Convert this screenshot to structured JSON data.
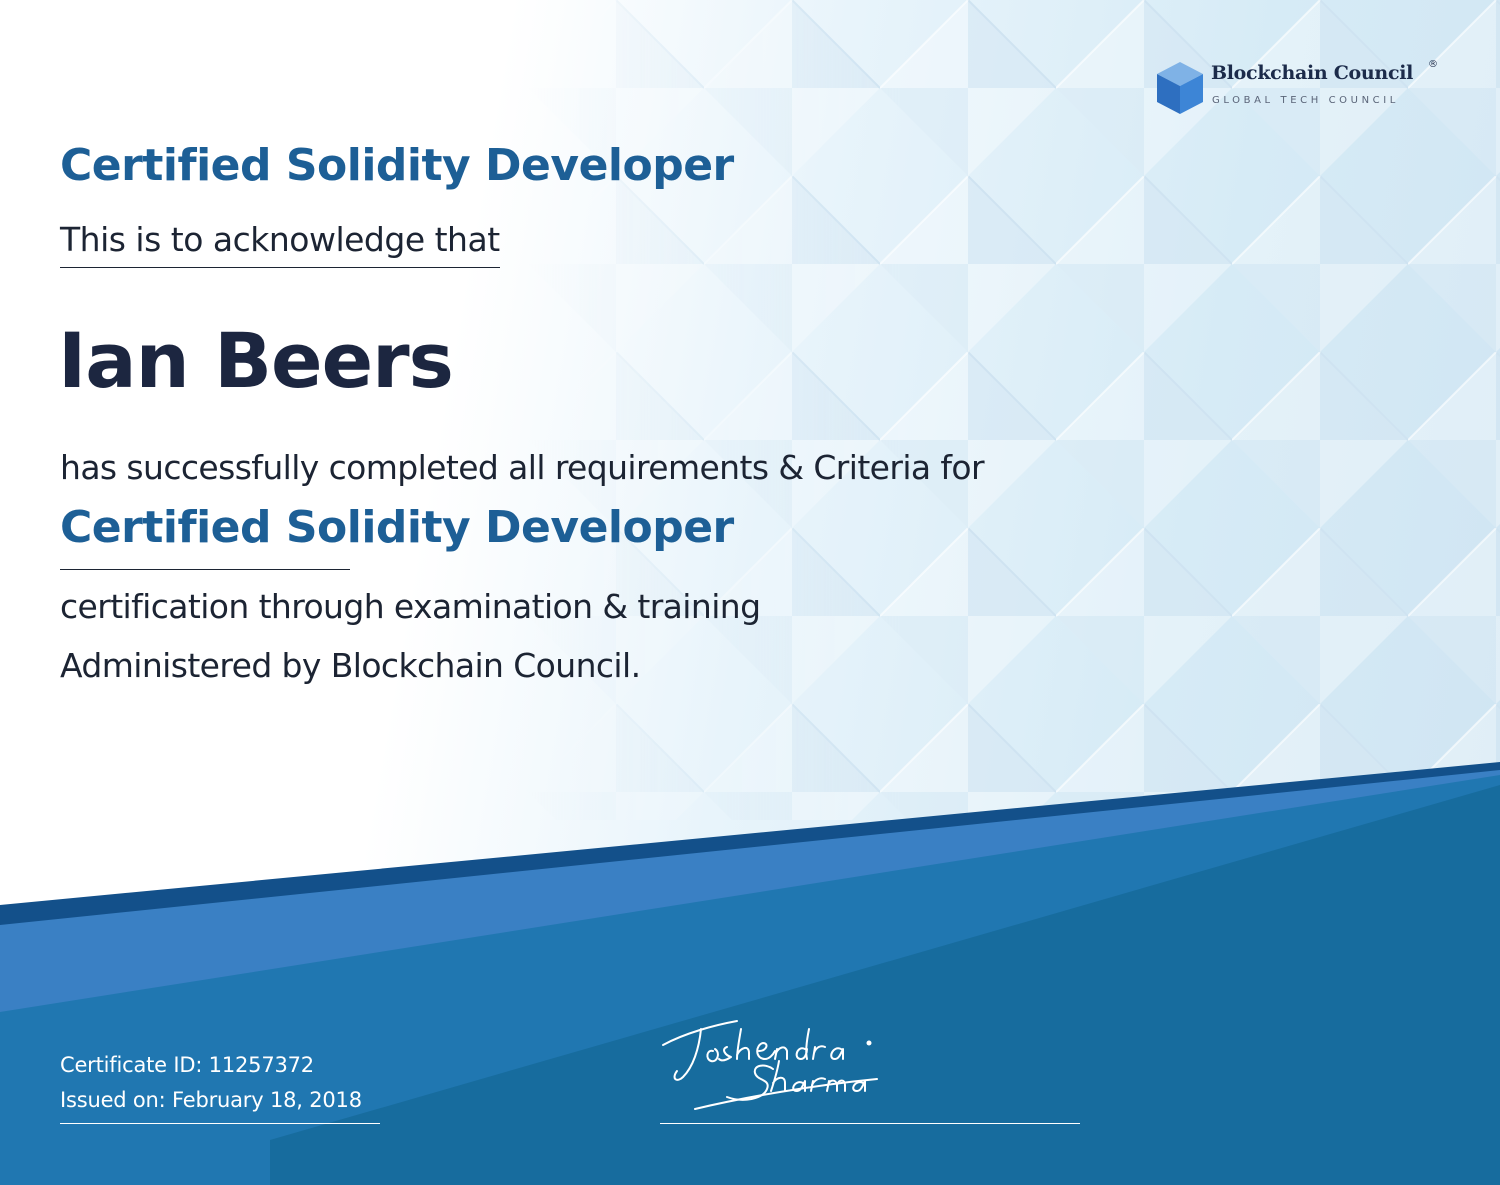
{
  "logo": {
    "name": "Blockchain Council",
    "registered_mark": "®",
    "tagline": "GLOBAL TECH COUNCIL"
  },
  "certificate": {
    "title_top": "Certified Solidity Developer",
    "acknowledge_text": "This is to acknowledge that",
    "recipient_name": "Ian Beers",
    "completed_text": "has successfully completed all requirements & Criteria for",
    "title_main": "Certified Solidity Developer",
    "certification_text": "certification through examination & training",
    "administered_text": "Administered by Blockchain Council.",
    "certificate_id": "Certificate ID: 11257372",
    "issued_on": "Issued on: February 18, 2018"
  },
  "signature": {
    "signer": "Toshendra Sharma"
  },
  "colors": {
    "title_blue": "#1d5f96",
    "dark_text": "#1c2433",
    "band_dark": "#0f4d82",
    "band_mid": "#1a6fa6",
    "band_light": "#3a82c6"
  }
}
